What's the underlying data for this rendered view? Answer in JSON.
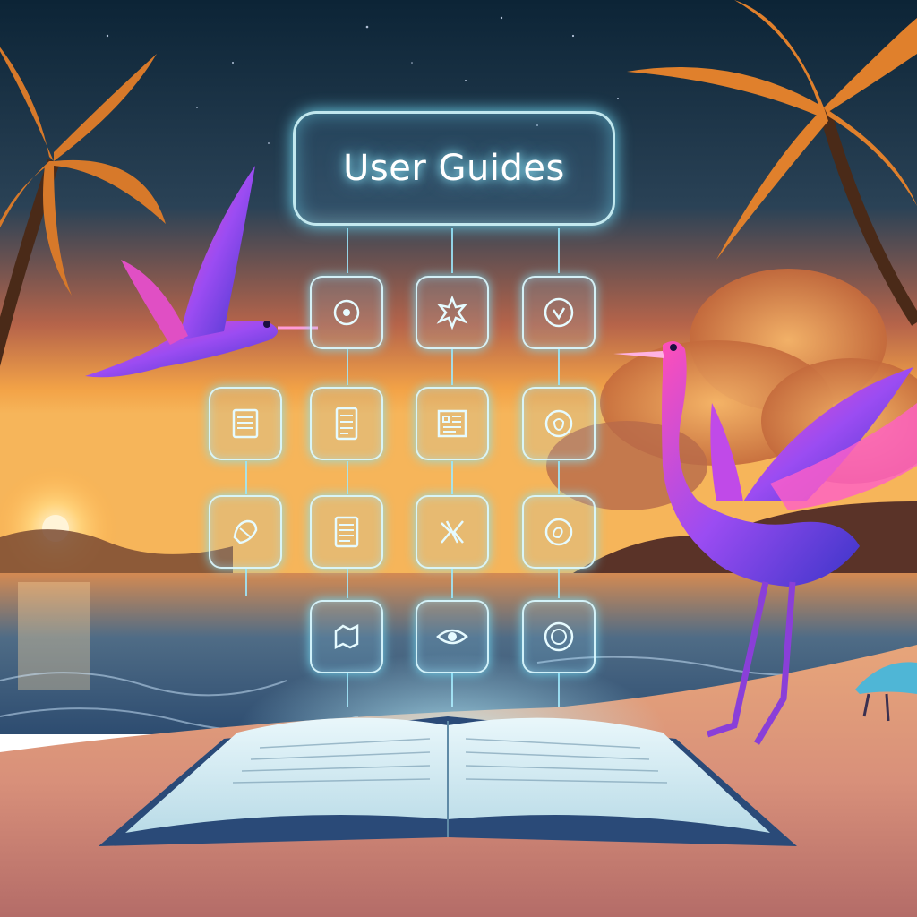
{
  "header": {
    "title": "User Guides"
  },
  "icons": {
    "row1": [
      "circle-icon",
      "figure-icon",
      "badge-icon"
    ],
    "row2": [
      "document-icon",
      "document-icon",
      "map-icon",
      "circle-icon"
    ],
    "row3": [
      "shape-icon",
      "document-icon",
      "shape-icon",
      "circle-icon"
    ],
    "row4": [
      "shape-icon",
      "eye-icon",
      "circle-icon"
    ]
  },
  "colors": {
    "glow": "#8fe8ff",
    "sky_top": "#0d2a3e",
    "sunset": "#f79a2b",
    "bird": "#9a4bf0"
  }
}
